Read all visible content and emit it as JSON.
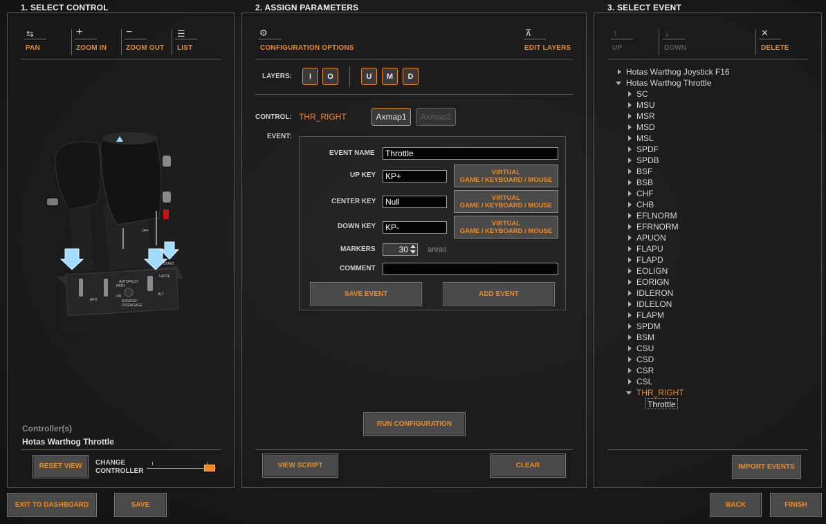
{
  "sections": {
    "select_control": "1. SELECT CONTROL",
    "assign_parameters": "2. ASSIGN PARAMETERS",
    "select_event": "3. SELECT EVENT"
  },
  "left": {
    "tools": [
      {
        "icon": "pan-icon",
        "glyph": "⇆",
        "label": "PAN"
      },
      {
        "icon": "zoom-in-icon",
        "glyph": "+",
        "label": "ZOOM IN"
      },
      {
        "icon": "zoom-out-icon",
        "glyph": "−",
        "label": "ZOOM OUT"
      },
      {
        "icon": "list-icon",
        "glyph": "☰",
        "label": "LIST"
      }
    ],
    "controllers_label": "Controller(s)",
    "controller_name": "Hotas Warthog Throttle",
    "reset_view": "RESET VIEW",
    "change_controller_line1": "CHANGE",
    "change_controller_line2": "CONTROLLER",
    "slider_level": 1.0
  },
  "middle": {
    "config_options_icon": "gear-icon",
    "config_options_glyph": "⚙",
    "config_options": "CONFIGURATION OPTIONS",
    "edit_layers_icon": "edit-layers-icon",
    "edit_layers_glyph": "⊼",
    "edit_layers": "EDIT LAYERS",
    "layers_label": "LAYERS:",
    "layers": [
      "I",
      "O",
      "U",
      "M",
      "D"
    ],
    "control_label": "CONTROL:",
    "control_value": "THR_RIGHT",
    "axmap1": "Axmap1",
    "axmap2": "Axmap2",
    "event_label": "EVENT:",
    "event_name_label": "EVENT NAME",
    "event_name_value": "Throttle",
    "up_key_label": "UP KEY",
    "up_key_value": "KP+",
    "center_key_label": "CENTER KEY",
    "center_key_value": "Null",
    "down_key_label": "DOWN KEY",
    "down_key_value": "KP-",
    "virtual_line1": "VIRTUAL",
    "virtual_line2": "GAME / KEYBOARD / MOUSE",
    "markers_label": "MARKERS",
    "markers_value": "30",
    "areas_label": "areas",
    "comment_label": "COMMENT",
    "comment_value": "",
    "save_event": "SAVE EVENT",
    "add_event": "ADD EVENT",
    "run_configuration": "RUN CONFIGURATION",
    "view_script": "VIEW SCRIPT",
    "clear": "CLEAR"
  },
  "right": {
    "up_icon": "arrow-up-icon",
    "up_glyph": "↑",
    "up": "UP",
    "down_icon": "arrow-down-icon",
    "down_glyph": "↓",
    "down": "DOWN",
    "delete_icon": "close-icon",
    "delete_glyph": "✕",
    "delete": "DELETE",
    "tree_root1": "Hotas Warthog Joystick F16",
    "tree_root2": "Hotas Warthog Throttle",
    "tree_children": [
      "SC",
      "MSU",
      "MSR",
      "MSD",
      "MSL",
      "SPDF",
      "SPDB",
      "BSF",
      "BSB",
      "CHF",
      "CHB",
      "EFLNORM",
      "EFRNORM",
      "APUON",
      "FLAPU",
      "FLAPD",
      "EOLIGN",
      "EORIGN",
      "IDLERON",
      "IDLELON",
      "FLAPM",
      "SPDM",
      "BSM",
      "CSU",
      "CSD",
      "CSR",
      "CSL"
    ],
    "tree_selected": "THR_RIGHT",
    "tree_selected_child": "Throttle",
    "import_events": "IMPORT EVENTS"
  },
  "footer": {
    "exit_dashboard": "EXIT TO DASHBOARD",
    "save": "SAVE",
    "back": "BACK",
    "finish": "FINISH"
  },
  "throttle_labels": {
    "autopilot": "AUTOPILOT",
    "engage": "ENGAGE/",
    "disengage": "DISENGAGE",
    "laste": "LASTE",
    "alt": "ALT",
    "path": "PATH",
    "apu": "APU",
    "off": "OFF",
    "on": "ON",
    "start": "START"
  },
  "colors": {
    "accent": "#f08a1c",
    "panel_border": "#555555"
  }
}
